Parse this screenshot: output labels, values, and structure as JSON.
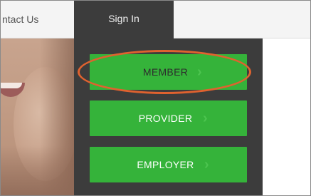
{
  "nav": {
    "contact_label": "ntact Us",
    "signin_label": "Sign In"
  },
  "signin_menu": {
    "items": [
      {
        "label": "MEMBER",
        "chevron": "›"
      },
      {
        "label": "PROVIDER",
        "chevron": "›"
      },
      {
        "label": "EMPLOYER",
        "chevron": "›"
      }
    ]
  },
  "colors": {
    "button_green": "#35b33a",
    "dropdown_bg": "#3c3c3c",
    "highlight_ring": "#e0622f"
  }
}
